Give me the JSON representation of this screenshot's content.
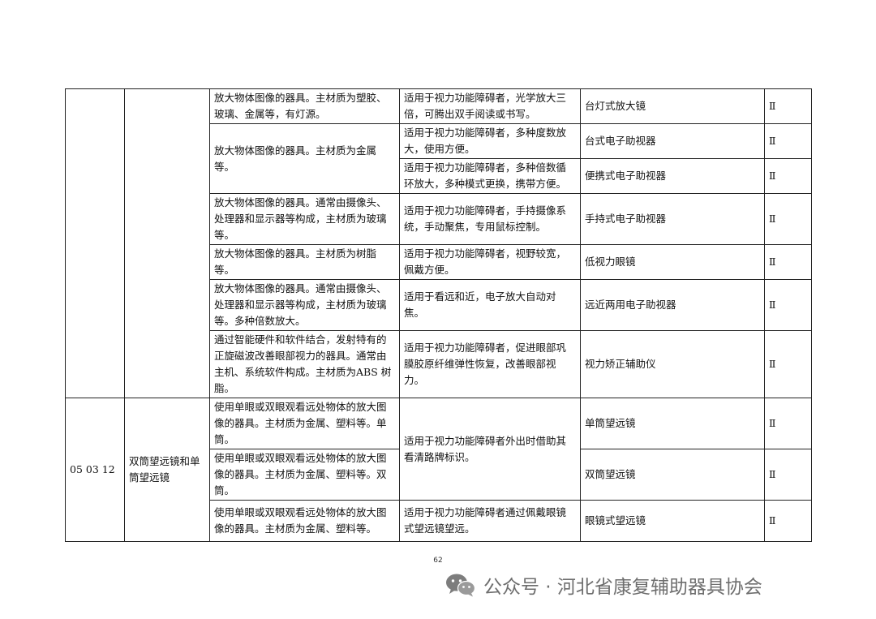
{
  "rows": [
    {
      "desc": "放大物体图像的器具。主材质为塑胶、玻璃、金属等，有灯源。",
      "use": "适用于视力功能障碍者，光学放大三倍，可腾出双手阅读或书写。",
      "name": "台灯式放大镜",
      "class": "Ⅱ"
    },
    {
      "desc": "放大物体图像的器具。主材质为金属等。",
      "use": "适用于视力功能障碍者，多种度数放大，使用方便。",
      "name": "台式电子助视器",
      "class": "Ⅱ"
    },
    {
      "use": "适用于视力功能障碍者，多种倍数循环放大，多种模式更换，携带方便。",
      "name": "便携式电子助视器",
      "class": "Ⅱ"
    },
    {
      "desc": "放大物体图像的器具。通常由摄像头、处理器和显示器等构成，主材质为玻璃等。",
      "use": "适用于视力功能障碍者，手持摄像系统，手动聚焦，专用鼠标控制。",
      "name": "手持式电子助视器",
      "class": "Ⅱ"
    },
    {
      "desc": "放大物体图像的器具。主材质为树脂等。",
      "use": "适用于视力功能障碍者，视野较宽，佩戴方便。",
      "name": "低视力眼镜",
      "class": "Ⅱ"
    },
    {
      "desc": "放大物体图像的器具。通常由摄像头、处理器和显示器等构成，主材质为玻璃等。多种倍数放大。",
      "use": "适用于看远和近，电子放大自动对焦。",
      "name": "远近两用电子助视器",
      "class": "Ⅱ"
    },
    {
      "desc": "通过智能硬件和软件结合，发射特有的正旋磁波改善眼部视力的器具。通常由主机、系统软件构成。主材质为ABS 树脂。",
      "use": "适用于视力功能障碍者，促进眼部巩膜胶原纤维弹性恢复，改善眼部视力。",
      "name": "视力矫正辅助仪",
      "class": "Ⅱ"
    }
  ],
  "telescope_group": {
    "code": "05 03 12",
    "category": "双筒望远镜和单筒望远镜",
    "rows": [
      {
        "desc": "使用单眼或双眼观看远处物体的放大图像的器具。主材质为金属、塑料等。单筒。",
        "use": "适用于视力功能障碍者外出时借助其看清路牌标识。",
        "name": "单筒望远镜",
        "class": "Ⅱ"
      },
      {
        "desc": "使用单眼或双眼观看远处物体的放大图像的器具。主材质为金属、塑料等。双筒。",
        "name": "双筒望远镜",
        "class": "Ⅱ"
      },
      {
        "desc": "使用单眼或双眼观看远处物体的放大图像的器具。主材质为金属、塑料等。",
        "use": "适用于视力功能障碍者通过佩戴眼镜式望远镜望远。",
        "name": "眼镜式望远镜",
        "class": "Ⅱ"
      }
    ]
  },
  "page_number": "62",
  "watermark": {
    "text": "公众号 · 河北省康复辅助器具协会",
    "icon": "wechat-icon"
  }
}
